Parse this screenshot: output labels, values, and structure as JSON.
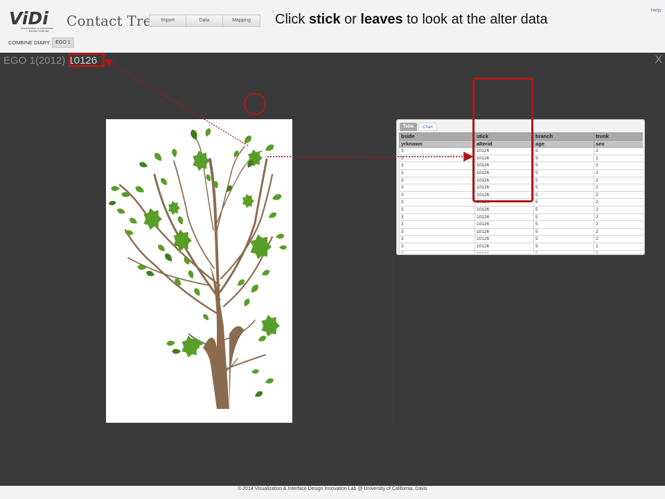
{
  "header": {
    "logo_text": "ViDi",
    "logo_sub": "Visualization & Interaction Design Institute",
    "title": "Contact Tree",
    "nav": [
      "Import",
      "Data",
      "Mapping"
    ],
    "instruction": {
      "p1": "Click ",
      "b1": "stick",
      "p2": " or ",
      "b2": "leaves",
      "p3": " to look at the alter data"
    },
    "help": "Help",
    "combine_label": "COMBINE DIARY:",
    "ego_button": "EGO 1"
  },
  "stage": {
    "ego_title": "EGO 1(2012)",
    "ego_id": "10126",
    "close": "X"
  },
  "data_panel": {
    "tabs": [
      "Table",
      "Chart"
    ],
    "headers": [
      "bside",
      "stick",
      "branch",
      "trunk"
    ],
    "subheaders": [
      "yrknown",
      "alterid",
      "age",
      "sex"
    ],
    "rows": [
      [
        "3",
        "10126",
        "5",
        "2"
      ],
      [
        "3",
        "10126",
        "5",
        "2"
      ],
      [
        "3",
        "10126",
        "5",
        "2"
      ],
      [
        "3",
        "10126",
        "5",
        "2"
      ],
      [
        "3",
        "10126",
        "5",
        "2"
      ],
      [
        "3",
        "10126",
        "5",
        "2"
      ],
      [
        "3",
        "10126",
        "5",
        "2"
      ],
      [
        "3",
        "10126",
        "5",
        "2"
      ],
      [
        "3",
        "10126",
        "5",
        "2"
      ],
      [
        "3",
        "10126",
        "5",
        "2"
      ],
      [
        "3",
        "10126",
        "5",
        "2"
      ],
      [
        "3",
        "10126",
        "5",
        "2"
      ],
      [
        "3",
        "10126",
        "5",
        "2"
      ],
      [
        "3",
        "10126",
        "5",
        "2"
      ],
      [
        "3",
        "10126",
        "5",
        "2"
      ],
      [
        "3",
        "10126",
        "5",
        "2"
      ]
    ]
  },
  "colors": {
    "trunk": "#8b6b4e",
    "leaf": "#5a9e2a",
    "leaf_dark": "#3f7d1c",
    "highlight": "#b01818",
    "stage": "#3a3a3a"
  },
  "footer": "© 2014 Visualization & Interface Design Innovation Lab @ University of California, Davis"
}
